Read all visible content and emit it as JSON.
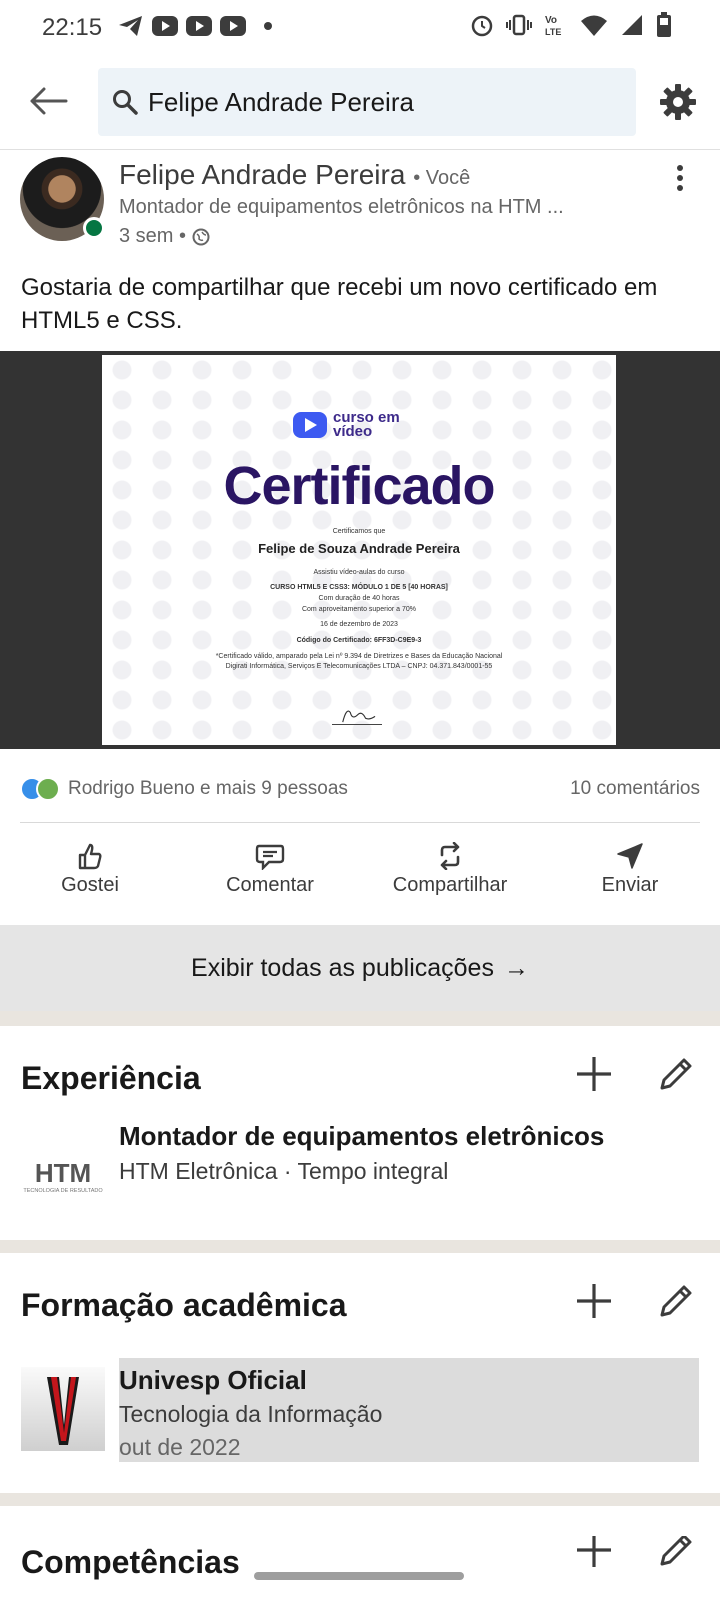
{
  "status_bar": {
    "time": "22:15",
    "left_icons": [
      "telegram-icon",
      "youtube-icon",
      "youtube-icon",
      "youtube-icon",
      "dot-icon"
    ],
    "right_icons": [
      "alarm-icon",
      "vibrate-icon",
      "volte-icon",
      "wifi-icon",
      "signal-icon",
      "battery-icon"
    ]
  },
  "header": {
    "search_value": "Felipe Andrade Pereira"
  },
  "post": {
    "author": "Felipe Andrade Pereira",
    "author_tag": "• Você",
    "headline": "Montador de equipamentos eletrônicos na HTM ...",
    "time": "3 sem •",
    "text": "Gostaria de compartilhar que recebi um novo certificado em HTML5 e CSS.",
    "certificate": {
      "logo": "curso em vídeo",
      "title": "Certificado",
      "certify_line": "Certificamos que",
      "recipient": "Felipe de Souza Andrade Pereira",
      "lines": [
        "Assistiu vídeo-aulas do curso",
        "CURSO HTML5 E CSS3: MÓDULO 1 DE 5 [40 HORAS]",
        "Com duração de 40 horas",
        "Com aproveitamento superior a 70%",
        "16 de dezembro de 2023",
        "Código do Certificado: 6FF3D-C9E9-3",
        "*Certificado válido, amparado pela Lei nº 9.394 de Diretrizes e Bases da Educação Nacional",
        "Digirati Informática, Serviços E Telecomunicações LTDA – CNPJ: 04.371.843/0001-55"
      ]
    },
    "reactors": "Rodrigo Bueno e mais 9 pessoas",
    "comments": "10 comentários",
    "actions": {
      "like": "Gostei",
      "comment": "Comentar",
      "share": "Compartilhar",
      "send": "Enviar"
    }
  },
  "show_all": {
    "label": "Exibir todas as publicações",
    "arrow": "→"
  },
  "experience": {
    "title": "Experiência",
    "items": [
      {
        "logo_text": "HTM",
        "logo_sub": "TECNOLOGIA DE RESULTADO",
        "role": "Montador de equipamentos eletrônicos",
        "company": "HTM Eletrônica · Tempo integral"
      }
    ]
  },
  "education": {
    "title": "Formação acadêmica",
    "items": [
      {
        "school": "Univesp Oficial",
        "field": "Tecnologia da Informação",
        "date": "out de 2022"
      }
    ]
  },
  "skills": {
    "title": "Competências"
  },
  "colors": {
    "accent_blue": "#0a66c2",
    "online_green": "#057642",
    "cert_purple": "#2a1563",
    "search_bg": "#edf3f8"
  }
}
